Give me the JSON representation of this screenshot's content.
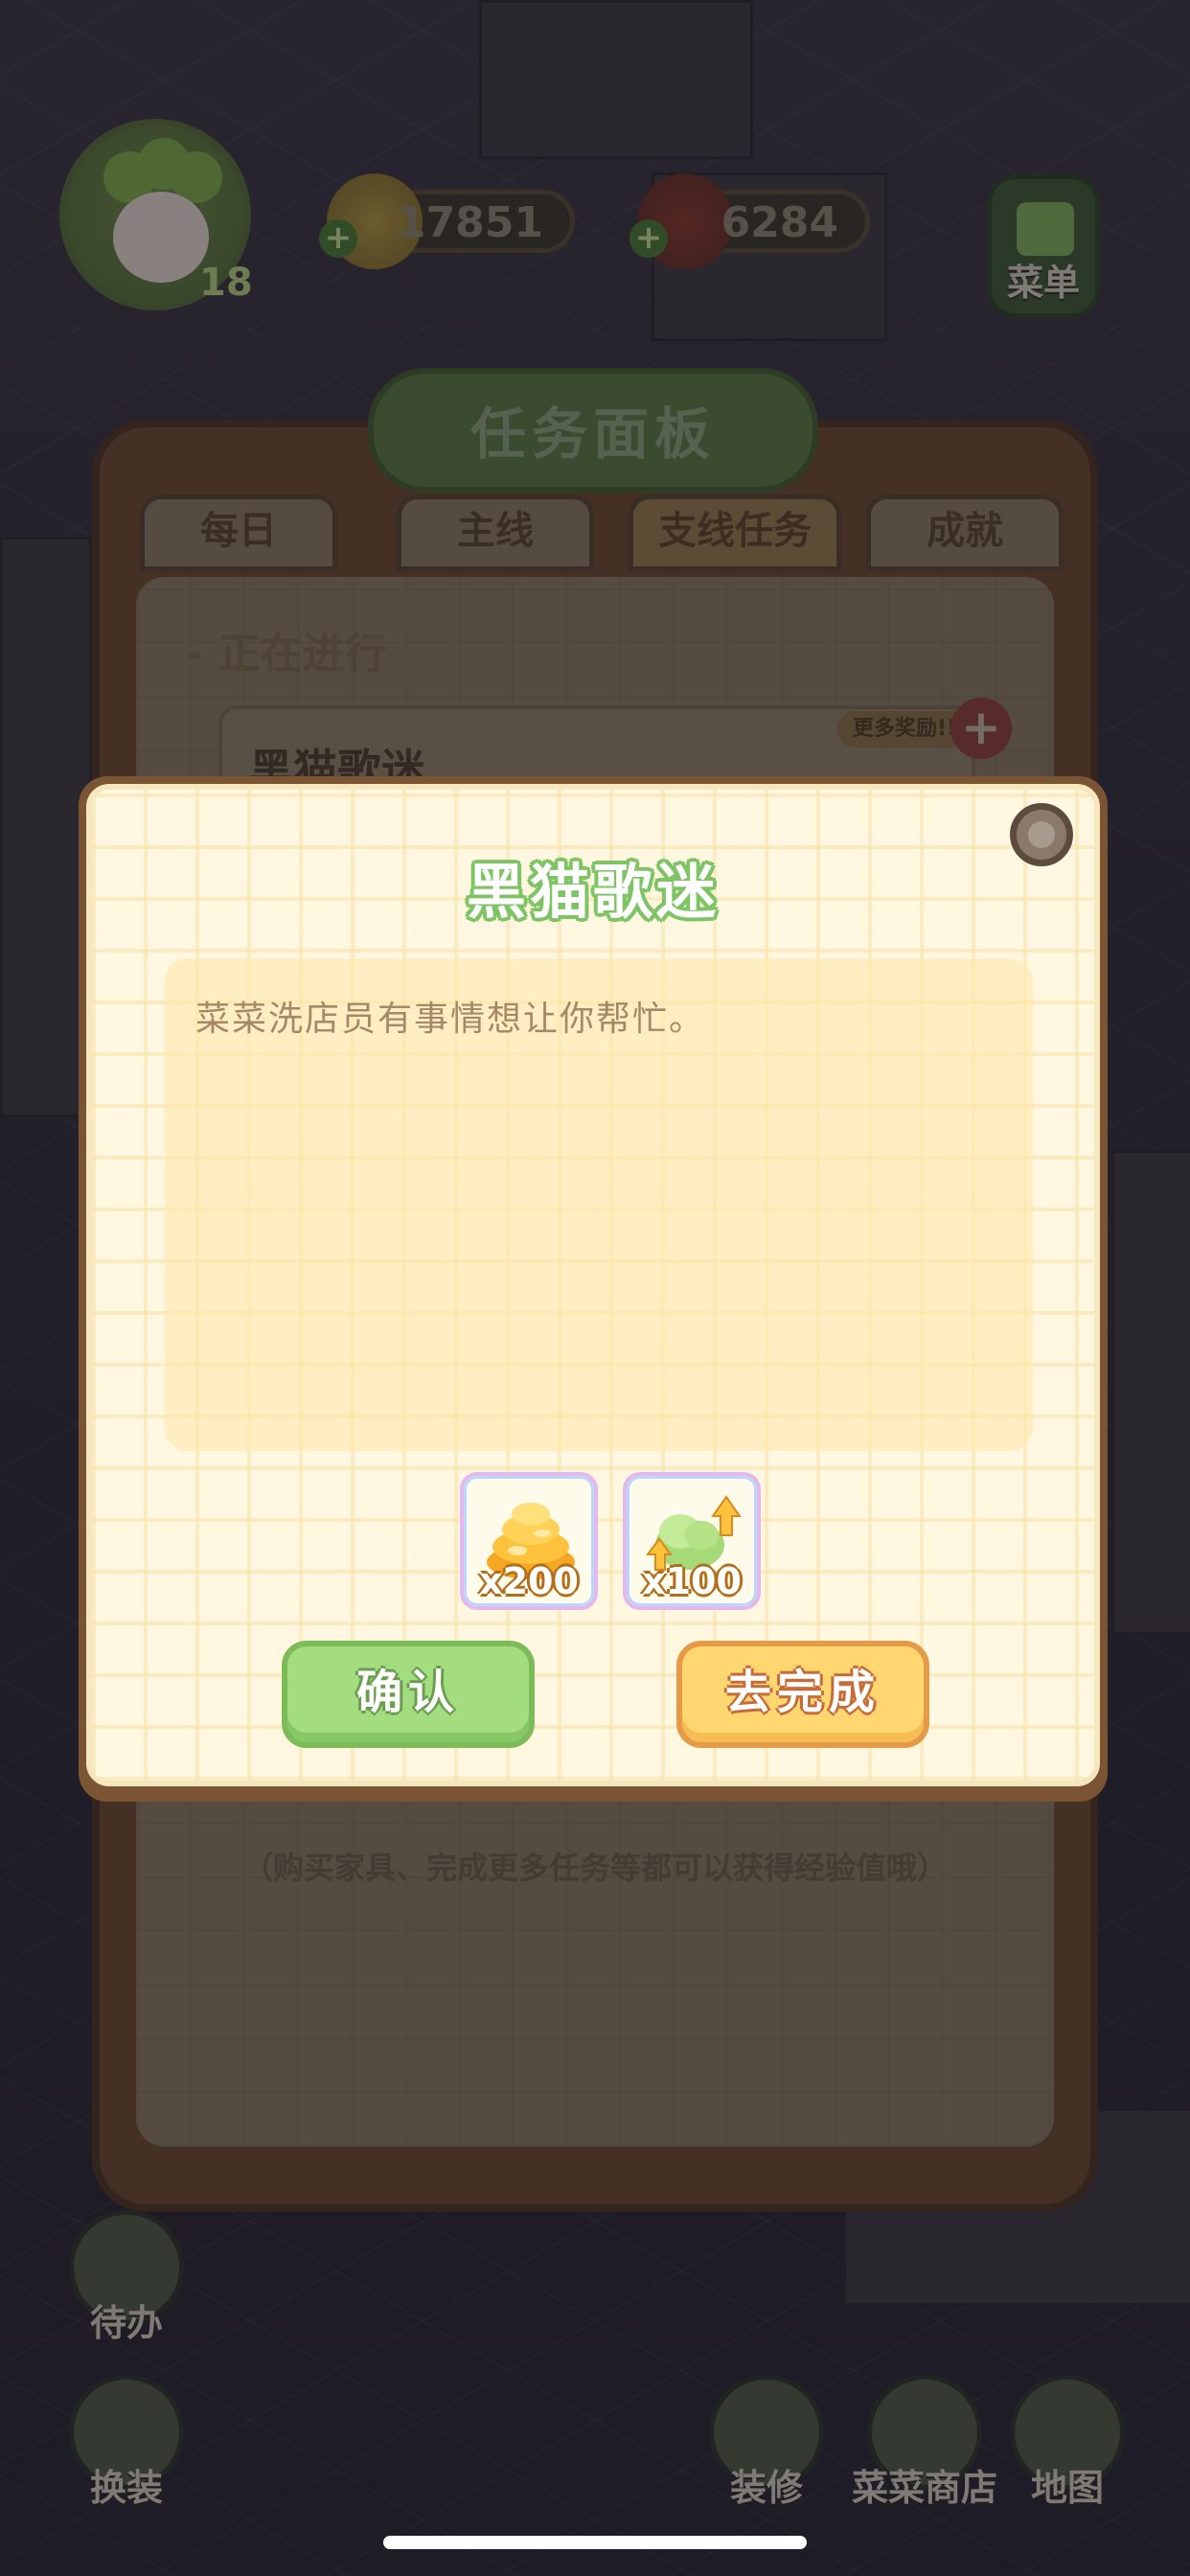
{
  "hud": {
    "player_level": "18",
    "coins": "17851",
    "ingredients": "6284",
    "menu_label": "菜单"
  },
  "task_board": {
    "title": "任务面板",
    "tabs": [
      {
        "label": "每日"
      },
      {
        "label": "主线"
      },
      {
        "label": "支线任务"
      },
      {
        "label": "成就"
      }
    ],
    "active_tab": "支线任务",
    "section_label": "- 正在进行",
    "task_name": "黑猫歌迷",
    "more_reward_badge": "更多奖励!!",
    "hint": "（购买家具、完成更多任务等都可以获得经验值哦）"
  },
  "side_buttons": {
    "todo": "待办",
    "dress": "换装",
    "decorate": "装修",
    "shop": "菜菜商店",
    "map": "地图"
  },
  "dialog": {
    "title": "黑猫歌迷",
    "description": "菜菜洗店员有事情想让你帮忙。",
    "rewards": [
      {
        "icon": "gold-coins-icon",
        "count": "x200"
      },
      {
        "icon": "exp-cabbage-icon",
        "count": "x100"
      }
    ],
    "confirm_label": "确认",
    "goto_label": "去完成"
  },
  "colors": {
    "dialog_title": "#7ec465",
    "confirm_button": "#a4dd80",
    "goto_button": "#ffd66f",
    "dialog_bg": "#fff7df"
  }
}
